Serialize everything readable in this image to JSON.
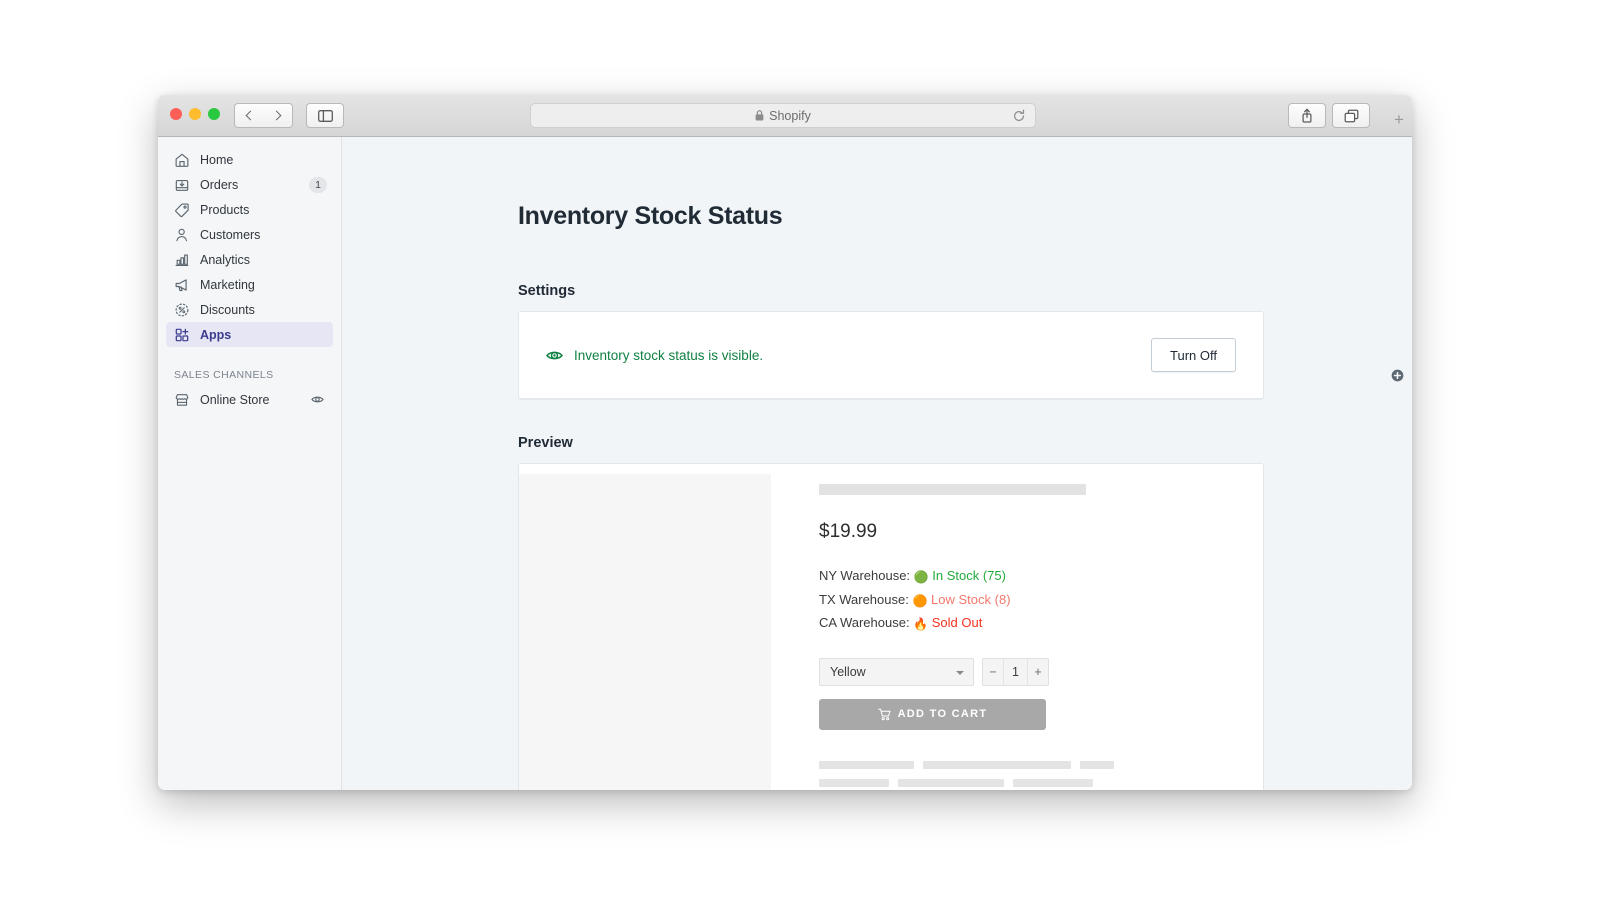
{
  "browser": {
    "address": "Shopify",
    "lock_icon": "lock-icon",
    "back_icon": "chevron-left-icon",
    "forward_icon": "chevron-right-icon",
    "sidebar_icon": "sidebar-toggle-icon",
    "reload_icon": "reload-icon",
    "share_icon": "share-icon",
    "tabs_icon": "tab-overview-icon",
    "new_tab_label": "+"
  },
  "sidebar": {
    "items": [
      {
        "label": "Home",
        "icon": "home-icon",
        "badge": null,
        "active": false
      },
      {
        "label": "Orders",
        "icon": "orders-icon",
        "badge": "1",
        "active": false
      },
      {
        "label": "Products",
        "icon": "products-tag-icon",
        "badge": null,
        "active": false
      },
      {
        "label": "Customers",
        "icon": "customers-icon",
        "badge": null,
        "active": false
      },
      {
        "label": "Analytics",
        "icon": "analytics-bars-icon",
        "badge": null,
        "active": false
      },
      {
        "label": "Marketing",
        "icon": "marketing-megaphone-icon",
        "badge": null,
        "active": false
      },
      {
        "label": "Discounts",
        "icon": "discounts-icon",
        "badge": null,
        "active": false
      },
      {
        "label": "Apps",
        "icon": "apps-grid-icon",
        "badge": null,
        "active": true
      }
    ],
    "sales_channels": {
      "header": "SALES CHANNELS",
      "add_icon": "plus-circle-icon",
      "items": [
        {
          "label": "Online Store",
          "icon": "storefront-icon",
          "trailing_icon": "eye-icon"
        }
      ]
    }
  },
  "main": {
    "page_title": "Inventory Stock Status",
    "settings": {
      "heading": "Settings",
      "status_icon": "eye-visible-icon",
      "status_text": "Inventory stock status is visible.",
      "status_color": "#108043",
      "button_label": "Turn Off"
    },
    "preview": {
      "heading": "Preview",
      "price": "$19.99",
      "stock_rows": [
        {
          "warehouse": "NY Warehouse:",
          "dot": "🟢",
          "state": "In Stock (75)",
          "color": "#22aa3b"
        },
        {
          "warehouse": "TX Warehouse:",
          "dot": "🟠",
          "state": "Low Stock (8)",
          "color": "#f4786c"
        },
        {
          "warehouse": "CA Warehouse:",
          "dot": "🔥",
          "state": "Sold Out",
          "color": "#f4321f"
        }
      ],
      "variant": {
        "value": "Yellow",
        "caret_icon": "chevron-down-icon"
      },
      "quantity": {
        "minus": "−",
        "value": "1",
        "plus": "+"
      },
      "add_to_cart": {
        "label": "ADD TO CART",
        "icon": "shopping-cart-icon"
      }
    }
  }
}
